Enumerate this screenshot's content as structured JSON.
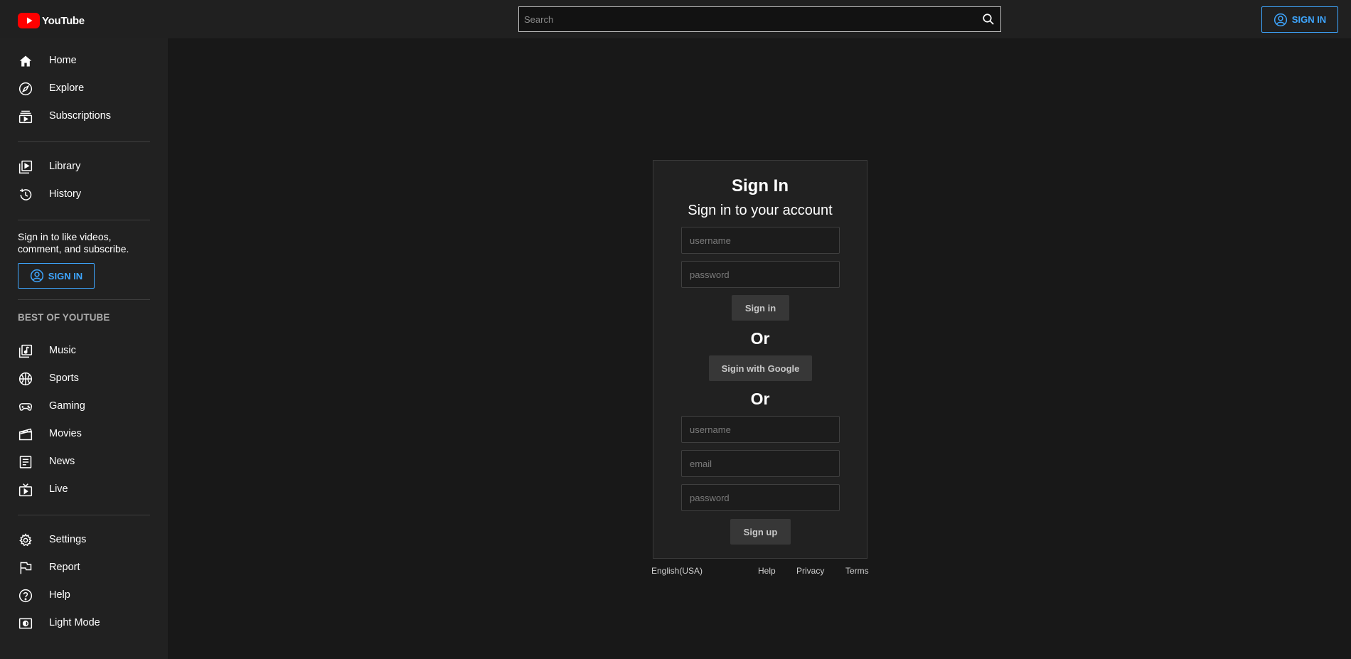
{
  "header": {
    "logo_text": "YouTube",
    "search_placeholder": "Search",
    "signin_label": "SIGN IN"
  },
  "sidebar": {
    "main_items": [
      {
        "label": "Home",
        "icon": "home-icon"
      },
      {
        "label": "Explore",
        "icon": "compass-icon"
      },
      {
        "label": "Subscriptions",
        "icon": "subscriptions-icon"
      }
    ],
    "library_items": [
      {
        "label": "Library",
        "icon": "library-icon"
      },
      {
        "label": "History",
        "icon": "history-icon"
      }
    ],
    "promo_text": "Sign in to like videos, comment, and subscribe.",
    "signin_label": "SIGN IN",
    "section_title": "BEST OF YOUTUBE",
    "best_items": [
      {
        "label": "Music",
        "icon": "music-icon"
      },
      {
        "label": "Sports",
        "icon": "sports-icon"
      },
      {
        "label": "Gaming",
        "icon": "gaming-icon"
      },
      {
        "label": "Movies",
        "icon": "movies-icon"
      },
      {
        "label": "News",
        "icon": "news-icon"
      },
      {
        "label": "Live",
        "icon": "live-icon"
      }
    ],
    "settings_items": [
      {
        "label": "Settings",
        "icon": "gear-icon"
      },
      {
        "label": "Report",
        "icon": "flag-icon"
      },
      {
        "label": "Help",
        "icon": "help-icon"
      },
      {
        "label": "Light Mode",
        "icon": "light-mode-icon"
      }
    ]
  },
  "signin_card": {
    "title": "Sign In",
    "subtitle": "Sign in to your account",
    "login_username_placeholder": "username",
    "login_password_placeholder": "password",
    "signin_button": "Sign in",
    "or_1": "Or",
    "google_button": "Sigin with Google",
    "or_2": "Or",
    "signup_username_placeholder": "username",
    "signup_email_placeholder": "email",
    "signup_password_placeholder": "password",
    "signup_button": "Sign up"
  },
  "footer": {
    "language": "English(USA)",
    "help": "Help",
    "privacy": "Privacy",
    "terms": "Terms"
  },
  "colors": {
    "background": "#181818",
    "surface": "#212121",
    "accent": "#3ea6ff",
    "brand_red": "#ff0000"
  }
}
